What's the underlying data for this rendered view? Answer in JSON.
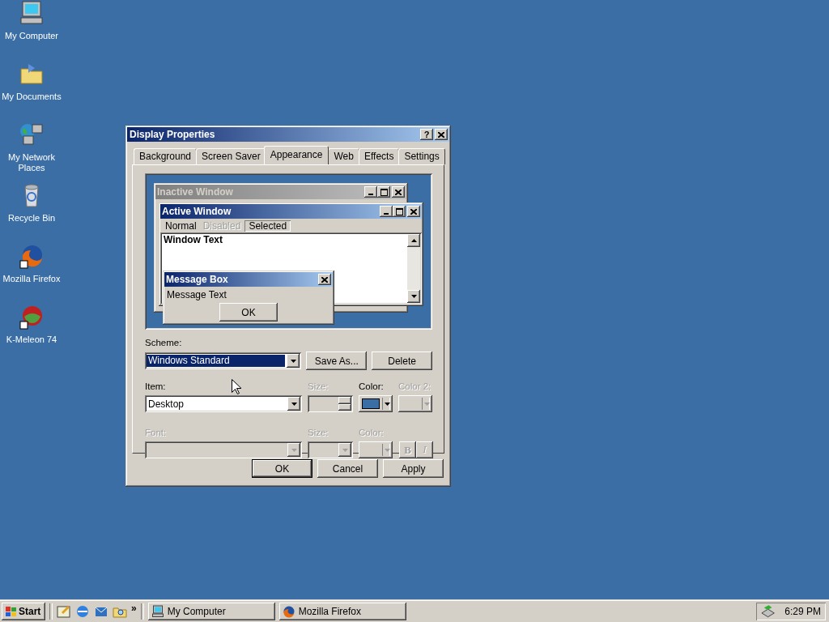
{
  "desktop_icons": [
    {
      "label": "My Computer",
      "kind": "computer"
    },
    {
      "label": "My Documents",
      "kind": "documents"
    },
    {
      "label": "My Network Places",
      "kind": "network"
    },
    {
      "label": "Recycle Bin",
      "kind": "recycle"
    },
    {
      "label": "Mozilla Firefox",
      "kind": "firefox"
    },
    {
      "label": "K-Meleon 74",
      "kind": "kmeleon"
    }
  ],
  "dialog": {
    "title": "Display Properties",
    "help": "?",
    "tabs": [
      {
        "label": "Background",
        "selected": false
      },
      {
        "label": "Screen Saver",
        "selected": false
      },
      {
        "label": "Appearance",
        "selected": true
      },
      {
        "label": "Web",
        "selected": false
      },
      {
        "label": "Effects",
        "selected": false
      },
      {
        "label": "Settings",
        "selected": false
      }
    ],
    "preview": {
      "inactive_title": "Inactive Window",
      "active_title": "Active Window",
      "menu": [
        {
          "label": "Normal",
          "disabled": false,
          "selected": false
        },
        {
          "label": "Disabled",
          "disabled": true,
          "selected": false
        },
        {
          "label": "Selected",
          "disabled": false,
          "selected": true
        }
      ],
      "window_text": "Window Text",
      "message_title": "Message Box",
      "message_text": "Message Text",
      "message_button": "OK"
    },
    "scheme": {
      "label": "Scheme:",
      "value": "Windows Standard"
    },
    "scheme_buttons": [
      "Save As...",
      "Delete"
    ],
    "item": {
      "label": "Item:",
      "value": "Desktop"
    },
    "item_size": {
      "label": "Size:",
      "disabled": true
    },
    "item_color": {
      "label": "Color:",
      "color": "#3a6ea5",
      "disabled": false
    },
    "item_color2": {
      "label": "Color 2:",
      "disabled": true
    },
    "font": {
      "label": "Font:",
      "disabled": true
    },
    "font_size": {
      "label": "Size:",
      "disabled": true
    },
    "font_color": {
      "label": "Color:",
      "disabled": true
    },
    "bold_button": {
      "label": "B",
      "disabled": true
    },
    "italic_button": {
      "label": "I",
      "disabled": true
    },
    "buttons": [
      "OK",
      "Cancel",
      "Apply"
    ]
  },
  "taskbar": {
    "start": "Start",
    "quick_launch": [
      {
        "kind": "desktop"
      },
      {
        "kind": "browser"
      },
      {
        "kind": "outlook"
      },
      {
        "kind": "search"
      }
    ],
    "more": "»",
    "tasks": [
      {
        "label": "My Computer",
        "kind": "computer"
      },
      {
        "label": "Mozilla Firefox",
        "kind": "firefox"
      }
    ],
    "clock": "6:29 PM"
  }
}
